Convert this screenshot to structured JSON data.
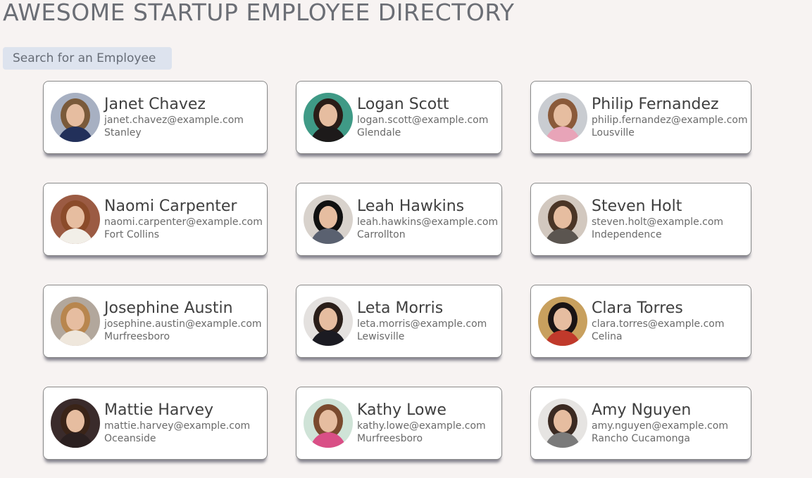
{
  "page": {
    "title": "AWESOME STARTUP EMPLOYEE DIRECTORY"
  },
  "search": {
    "placeholder": "Search for an Employee"
  },
  "employees": [
    {
      "name": "Janet Chavez",
      "email": "janet.chavez@example.com",
      "city": "Stanley",
      "bg": "#a7b0c2",
      "hair": "#7a5a3a",
      "shirt": "#22305a"
    },
    {
      "name": "Logan Scott",
      "email": "logan.scott@example.com",
      "city": "Glendale",
      "bg": "#3f9a86",
      "hair": "#2a1d18",
      "shirt": "#1d1a1a"
    },
    {
      "name": "Philip Fernandez",
      "email": "philip.fernandez@example.com",
      "city": "Lousville",
      "bg": "#c9ccd1",
      "hair": "#8a5a3a",
      "shirt": "#e8a4b8"
    },
    {
      "name": "Naomi Carpenter",
      "email": "naomi.carpenter@example.com",
      "city": "Fort Collins",
      "bg": "#9b5b43",
      "hair": "#8b4b2a",
      "shirt": "#f2efe8"
    },
    {
      "name": "Leah Hawkins",
      "email": "leah.hawkins@example.com",
      "city": "Carrollton",
      "bg": "#d8d2cc",
      "hair": "#111111",
      "shirt": "#5a6170"
    },
    {
      "name": "Steven Holt",
      "email": "steven.holt@example.com",
      "city": "Independence",
      "bg": "#d2c8bf",
      "hair": "#4a3526",
      "shirt": "#5b5550"
    },
    {
      "name": "Josephine Austin",
      "email": "josephine.austin@example.com",
      "city": "Murfreesboro",
      "bg": "#b2a79c",
      "hair": "#b8864e",
      "shirt": "#efe7dc"
    },
    {
      "name": "Leta Morris",
      "email": "leta.morris@example.com",
      "city": "Lewisville",
      "bg": "#e4e1df",
      "hair": "#2a1e19",
      "shirt": "#1b1b22"
    },
    {
      "name": "Clara Torres",
      "email": "clara.torres@example.com",
      "city": "Celina",
      "bg": "#c8a05e",
      "hair": "#1a1414",
      "shirt": "#c0392b"
    },
    {
      "name": "Mattie Harvey",
      "email": "mattie.harvey@example.com",
      "city": "Oceanside",
      "bg": "#3a2b2b",
      "hair": "#3a2418",
      "shirt": "#2b2020"
    },
    {
      "name": "Kathy Lowe",
      "email": "kathy.lowe@example.com",
      "city": "Murfreesboro",
      "bg": "#cfe3d7",
      "hair": "#7a4a2e",
      "shirt": "#d94f86"
    },
    {
      "name": "Amy Nguyen",
      "email": "amy.nguyen@example.com",
      "city": "Rancho Cucamonga",
      "bg": "#e6e4e2",
      "hair": "#3b2a22",
      "shirt": "#7a7a7a"
    }
  ]
}
